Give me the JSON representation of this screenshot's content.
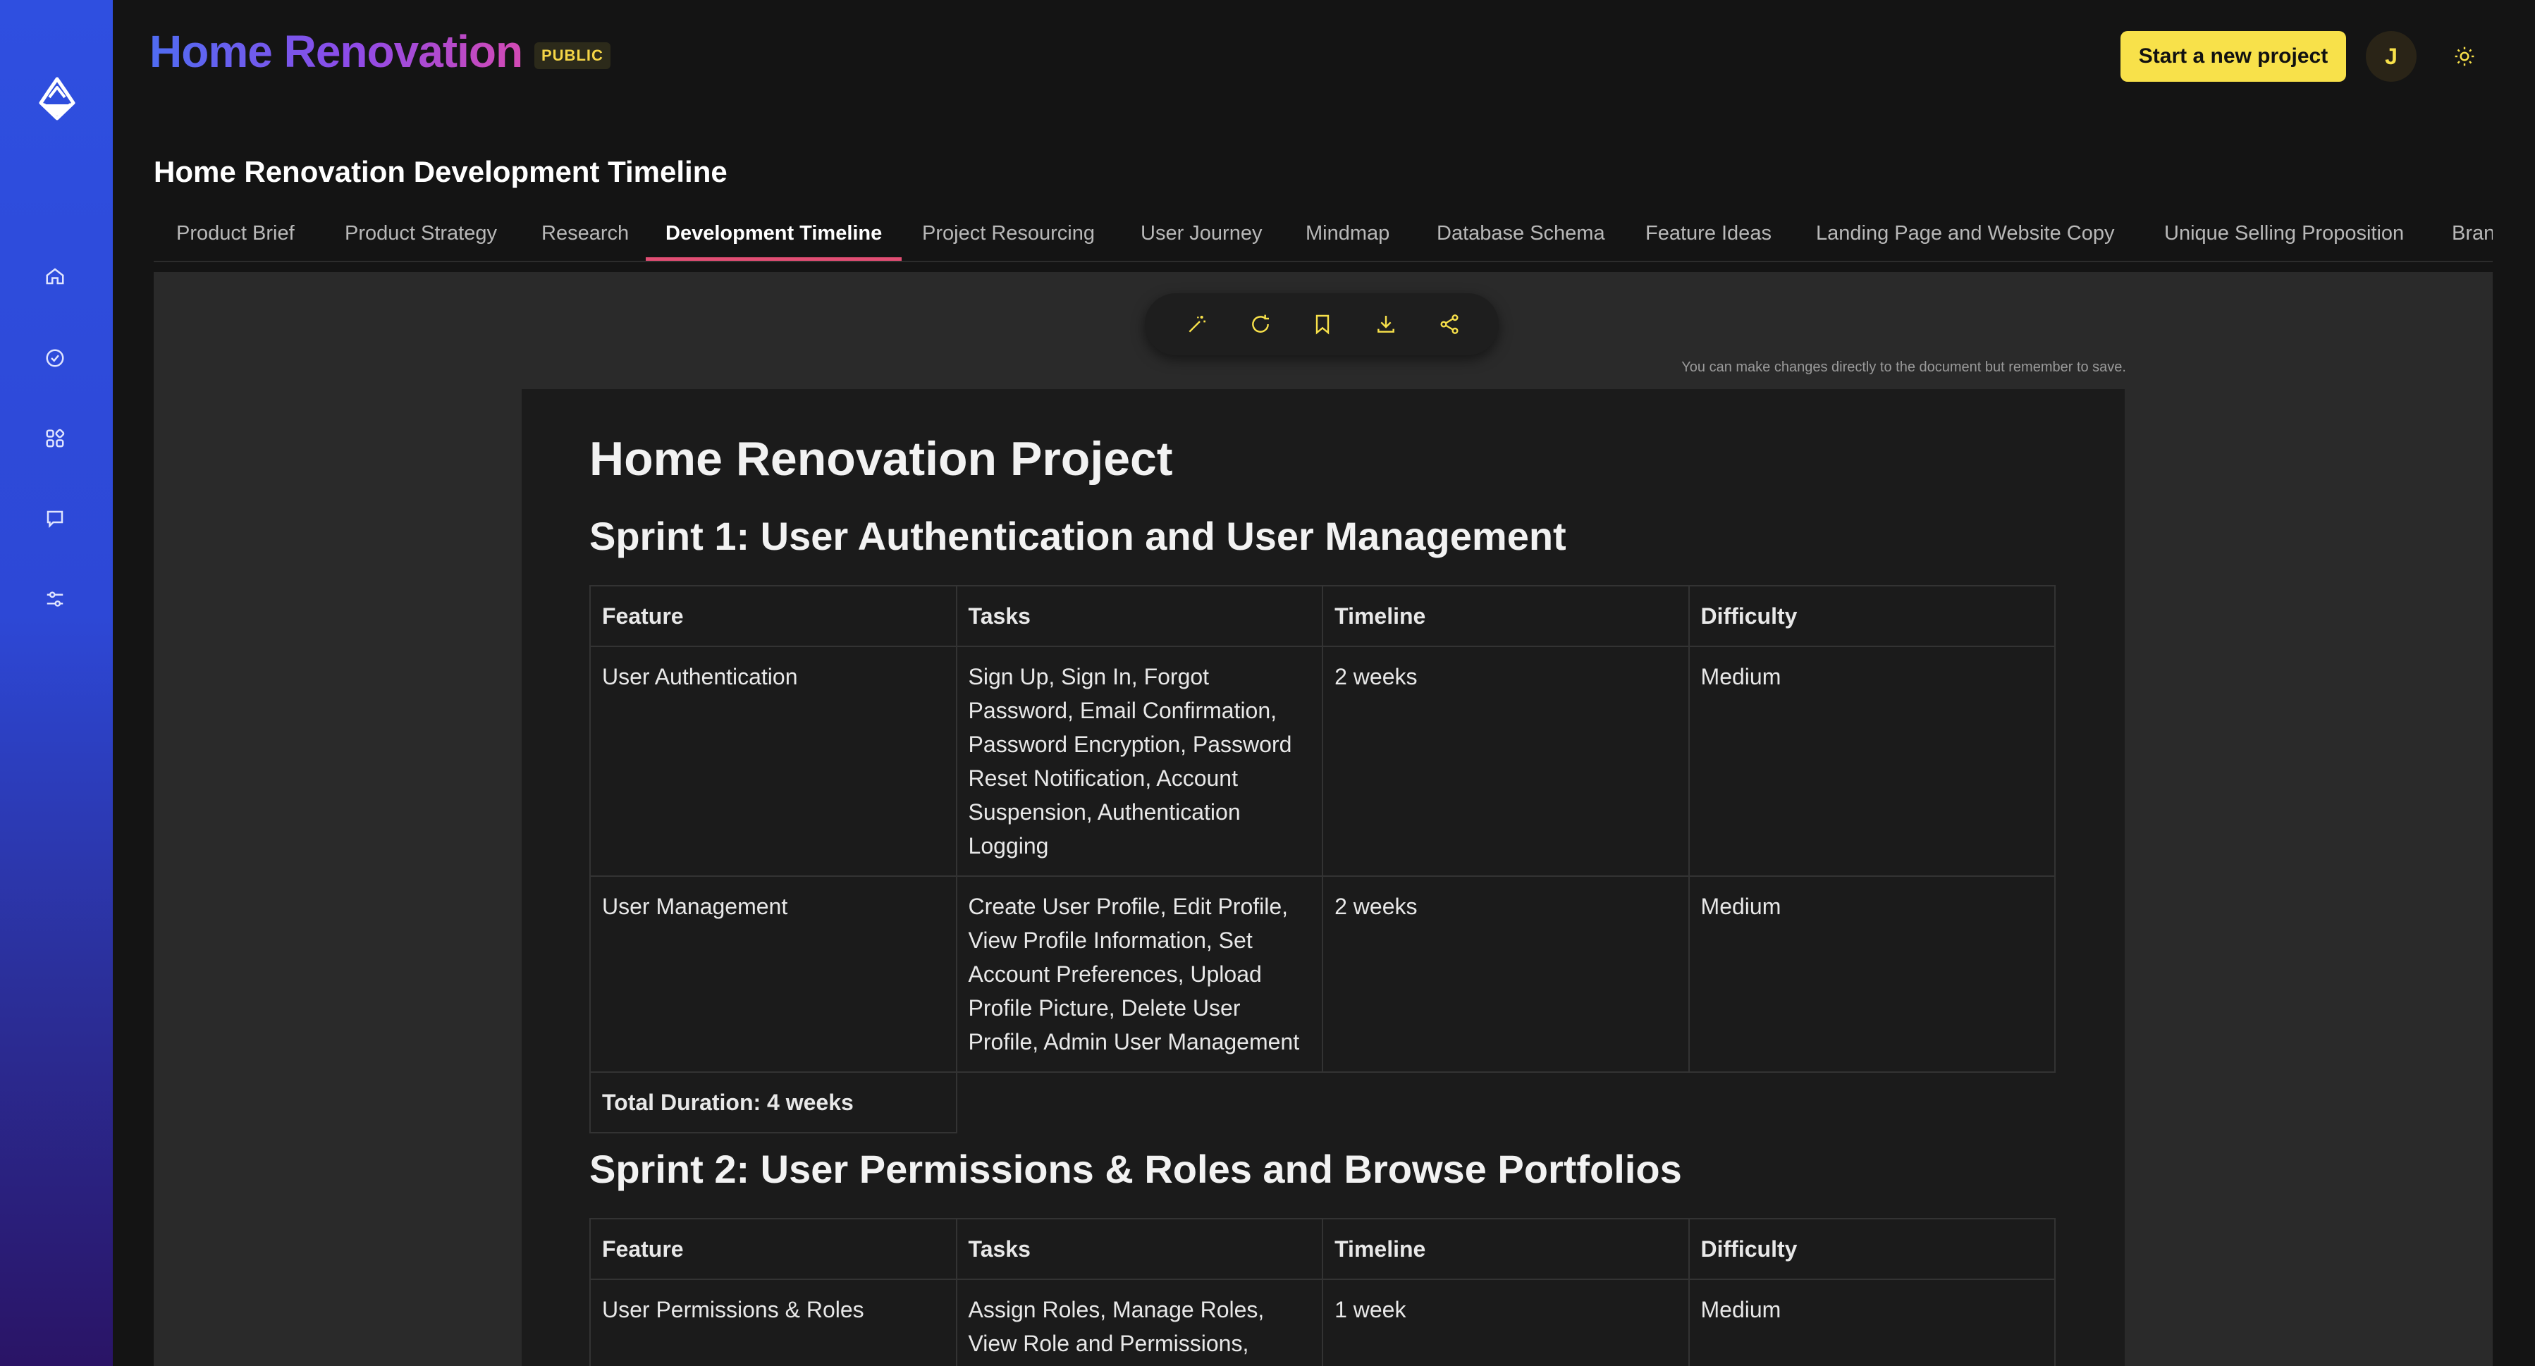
{
  "app": {
    "brand": "Home Renovation",
    "badge": "PUBLIC",
    "new_project_label": "Start a new project",
    "avatar_initial": "J",
    "accent": "#f8e14a",
    "sidebar_gradient": [
      "#2f4fe0",
      "#2a1466"
    ]
  },
  "sidebar": {
    "items": [
      {
        "icon": "home-icon"
      },
      {
        "icon": "check-circle-icon"
      },
      {
        "icon": "apps-icon"
      },
      {
        "icon": "chat-icon"
      },
      {
        "icon": "sliders-icon"
      }
    ]
  },
  "page": {
    "title": "Home Renovation Development Timeline"
  },
  "tabs": [
    {
      "label": "Product Brief"
    },
    {
      "label": "Product Strategy"
    },
    {
      "label": "Research"
    },
    {
      "label": "Development Timeline",
      "active": true
    },
    {
      "label": "Project Resourcing"
    },
    {
      "label": "User Journey"
    },
    {
      "label": "Mindmap"
    },
    {
      "label": "Database Schema"
    },
    {
      "label": "Feature Ideas"
    },
    {
      "label": "Landing Page and Website Copy"
    },
    {
      "label": "Unique Selling Proposition"
    },
    {
      "label": "Bran"
    }
  ],
  "toolbar": {
    "tools": [
      "magic-wand-icon",
      "refresh-icon",
      "bookmark-icon",
      "download-icon",
      "share-icon"
    ],
    "hint": "You can make changes directly to the document but remember to save."
  },
  "document": {
    "title": "Home Renovation Project",
    "headers": [
      "Feature",
      "Tasks",
      "Timeline",
      "Difficulty"
    ],
    "sprint1": {
      "heading": "Sprint 1: User Authentication and User Management",
      "rows": [
        {
          "feature": "User Authentication",
          "tasks": "Sign Up, Sign In, Forgot Password, Email Confirmation, Password Encryption, Password Reset Notification, Account Suspension, Authentication Logging",
          "timeline": "2 weeks",
          "difficulty": "Medium"
        },
        {
          "feature": "User Management",
          "tasks": "Create User Profile, Edit Profile, View Profile Information, Set Account Preferences, Upload Profile Picture, Delete User Profile, Admin User Management",
          "timeline": "2 weeks",
          "difficulty": "Medium"
        }
      ],
      "total": "Total Duration: 4 weeks"
    },
    "sprint2": {
      "heading": "Sprint 2: User Permissions & Roles and Browse Portfolios",
      "rows": [
        {
          "feature": "User Permissions & Roles",
          "tasks": "Assign Roles, Manage Roles, View Role and Permissions, Restrict Functionalities U",
          "timeline": "1 week",
          "difficulty": "Medium"
        }
      ]
    }
  }
}
